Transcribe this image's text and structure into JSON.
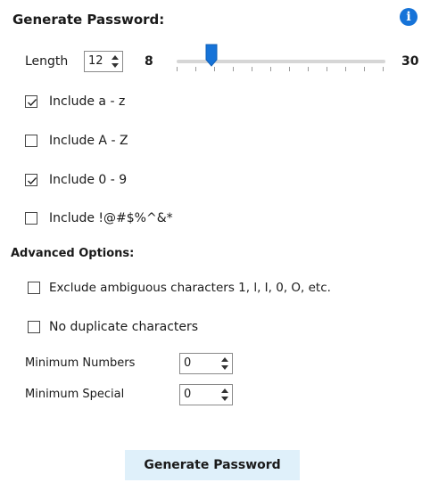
{
  "title": "Generate Password:",
  "info_icon": "info-icon",
  "length": {
    "label": "Length",
    "value": "12",
    "min_label": "8",
    "max_label": "30",
    "slider_value": 12
  },
  "options": [
    {
      "label": "Include a - z",
      "checked": true
    },
    {
      "label": "Include A - Z",
      "checked": false
    },
    {
      "label": "Include 0 - 9",
      "checked": true
    },
    {
      "label": "Include !@#$%^&*",
      "checked": false
    }
  ],
  "advanced": {
    "title": "Advanced Options:",
    "options": [
      {
        "label": "Exclude ambiguous characters 1, l, I, 0, O, etc.",
        "checked": false
      },
      {
        "label": "No duplicate characters",
        "checked": false
      }
    ],
    "minimum_numbers": {
      "label": "Minimum Numbers",
      "value": "0"
    },
    "minimum_special": {
      "label": "Minimum Special",
      "value": "0"
    }
  },
  "generate_button": "Generate Password"
}
